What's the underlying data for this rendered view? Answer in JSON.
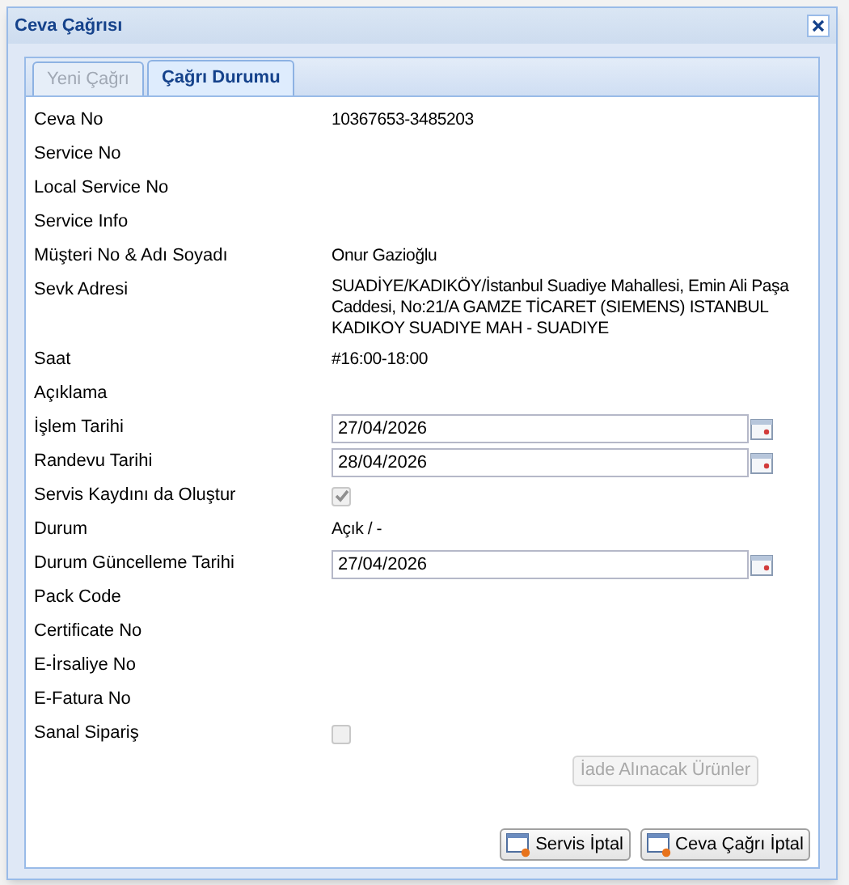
{
  "window": {
    "title": "Ceva Çağrısı"
  },
  "tabs": [
    {
      "label": "Yeni Çağrı",
      "selected": false,
      "disabled": true
    },
    {
      "label": "Çağrı Durumu",
      "selected": true,
      "disabled": false
    }
  ],
  "fields": [
    {
      "kind": "text",
      "label": "Ceva No",
      "value": "10367653-3485203"
    },
    {
      "kind": "text",
      "label": "Service No"
    },
    {
      "kind": "text",
      "label": "Local Service No"
    },
    {
      "kind": "text",
      "label": "Service Info"
    },
    {
      "kind": "text",
      "label": "Müşteri No & Adı Soyadı",
      "value": "Onur Gazioğlu"
    },
    {
      "kind": "text",
      "label": "Sevk Adresi",
      "value": "SUADİYE/KADIKÖY/İstanbul Suadiye Mahallesi, Emin Ali Paşa Caddesi, No:21/A GAMZE TİCARET (SIEMENS) ISTANBUL KADIKOY SUADIYE MAH - SUADIYE"
    },
    {
      "kind": "text",
      "label": "Saat",
      "value": "#16:00-18:00"
    },
    {
      "kind": "text",
      "label": "Açıklama"
    },
    {
      "kind": "date",
      "label": "İşlem Tarihi",
      "value": "27/04/2026"
    },
    {
      "kind": "date",
      "label": "Randevu Tarihi",
      "value": "28/04/2026"
    },
    {
      "kind": "checkbox",
      "label": "Servis Kaydını da Oluştur",
      "checked": true,
      "disabled": true
    },
    {
      "kind": "text",
      "label": "Durum",
      "value": "Açık / -"
    },
    {
      "kind": "date",
      "label": "Durum Güncelleme Tarihi",
      "value": "27/04/2026"
    },
    {
      "kind": "text",
      "label": "Pack Code"
    },
    {
      "kind": "text",
      "label": "Certificate No"
    },
    {
      "kind": "text",
      "label": "E-İrsaliye No"
    },
    {
      "kind": "text",
      "label": "E-Fatura No"
    },
    {
      "kind": "checkbox",
      "label": "Sanal Sipariş",
      "checked": false,
      "disabled": true
    }
  ],
  "return_button": {
    "label": "İade Alınacak Ürünler",
    "disabled": true
  },
  "buttons": [
    {
      "label": "Servis İptal"
    },
    {
      "label": "Ceva Çağrı İptal"
    }
  ]
}
